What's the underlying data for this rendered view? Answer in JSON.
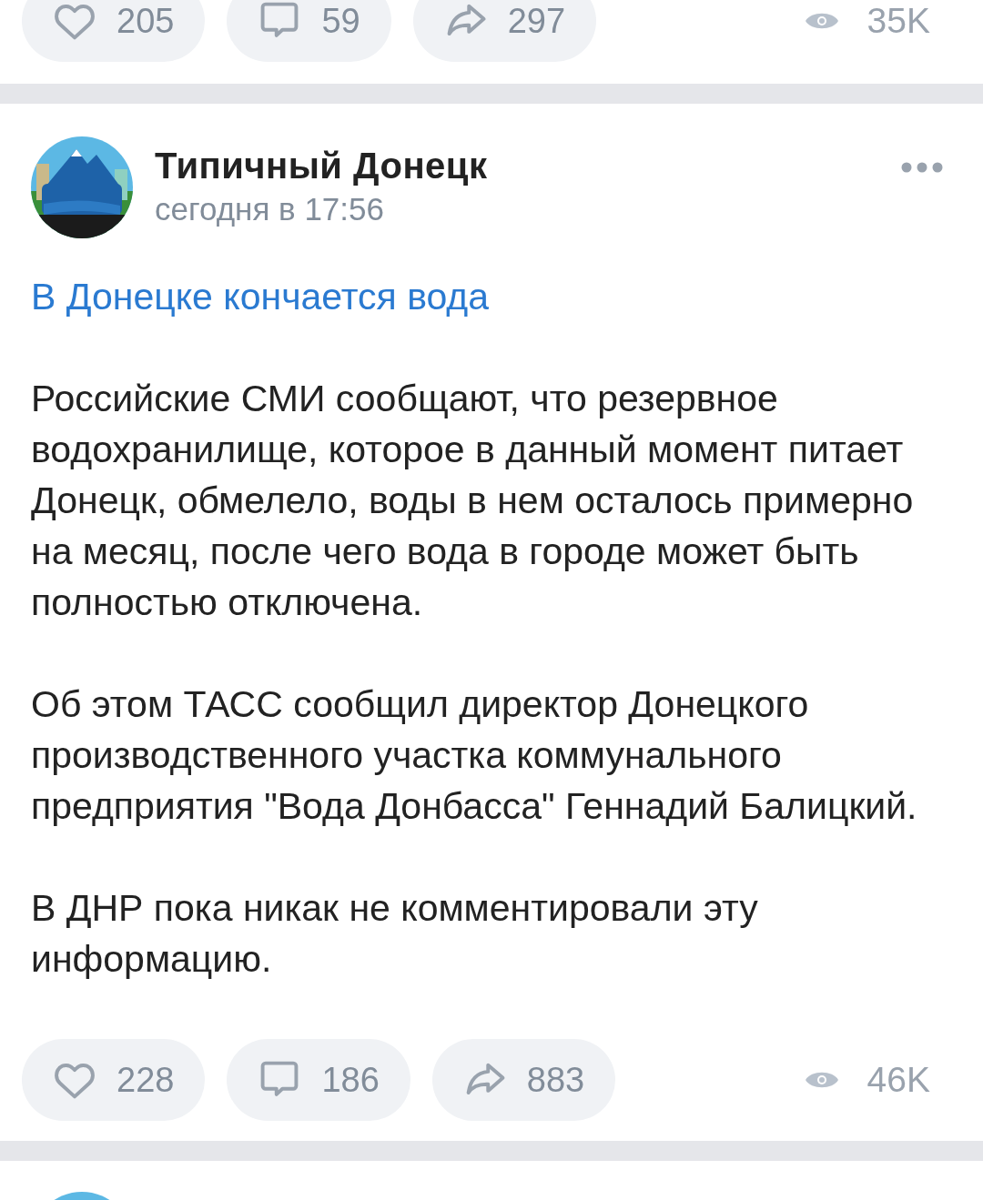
{
  "previous_post": {
    "actions": [
      {
        "kind": "like",
        "count": "205"
      },
      {
        "kind": "comment",
        "count": "59"
      },
      {
        "kind": "share",
        "count": "297"
      }
    ],
    "views": "35K"
  },
  "post": {
    "author": "Типичный Донецк",
    "time": "сегодня в 17:56",
    "title": "В Донецке кончается вода",
    "paragraphs": [
      "Российские СМИ сообщают, что резервное водохранилище, которое в данный момент питает Донецк, обмелело, воды в нем осталось примерно на месяц, после чего вода в городе может быть полностью отключена.",
      "Об этом ТАСС сообщил директор Донецкого производственного участка коммунального предприятия \"Вода Донбасса\" Геннадий Балицкий.",
      "В ДНР пока никак не комментировали эту информацию."
    ],
    "actions": [
      {
        "kind": "like",
        "count": "228"
      },
      {
        "kind": "comment",
        "count": "186"
      },
      {
        "kind": "share",
        "count": "883"
      }
    ],
    "views": "46K"
  }
}
